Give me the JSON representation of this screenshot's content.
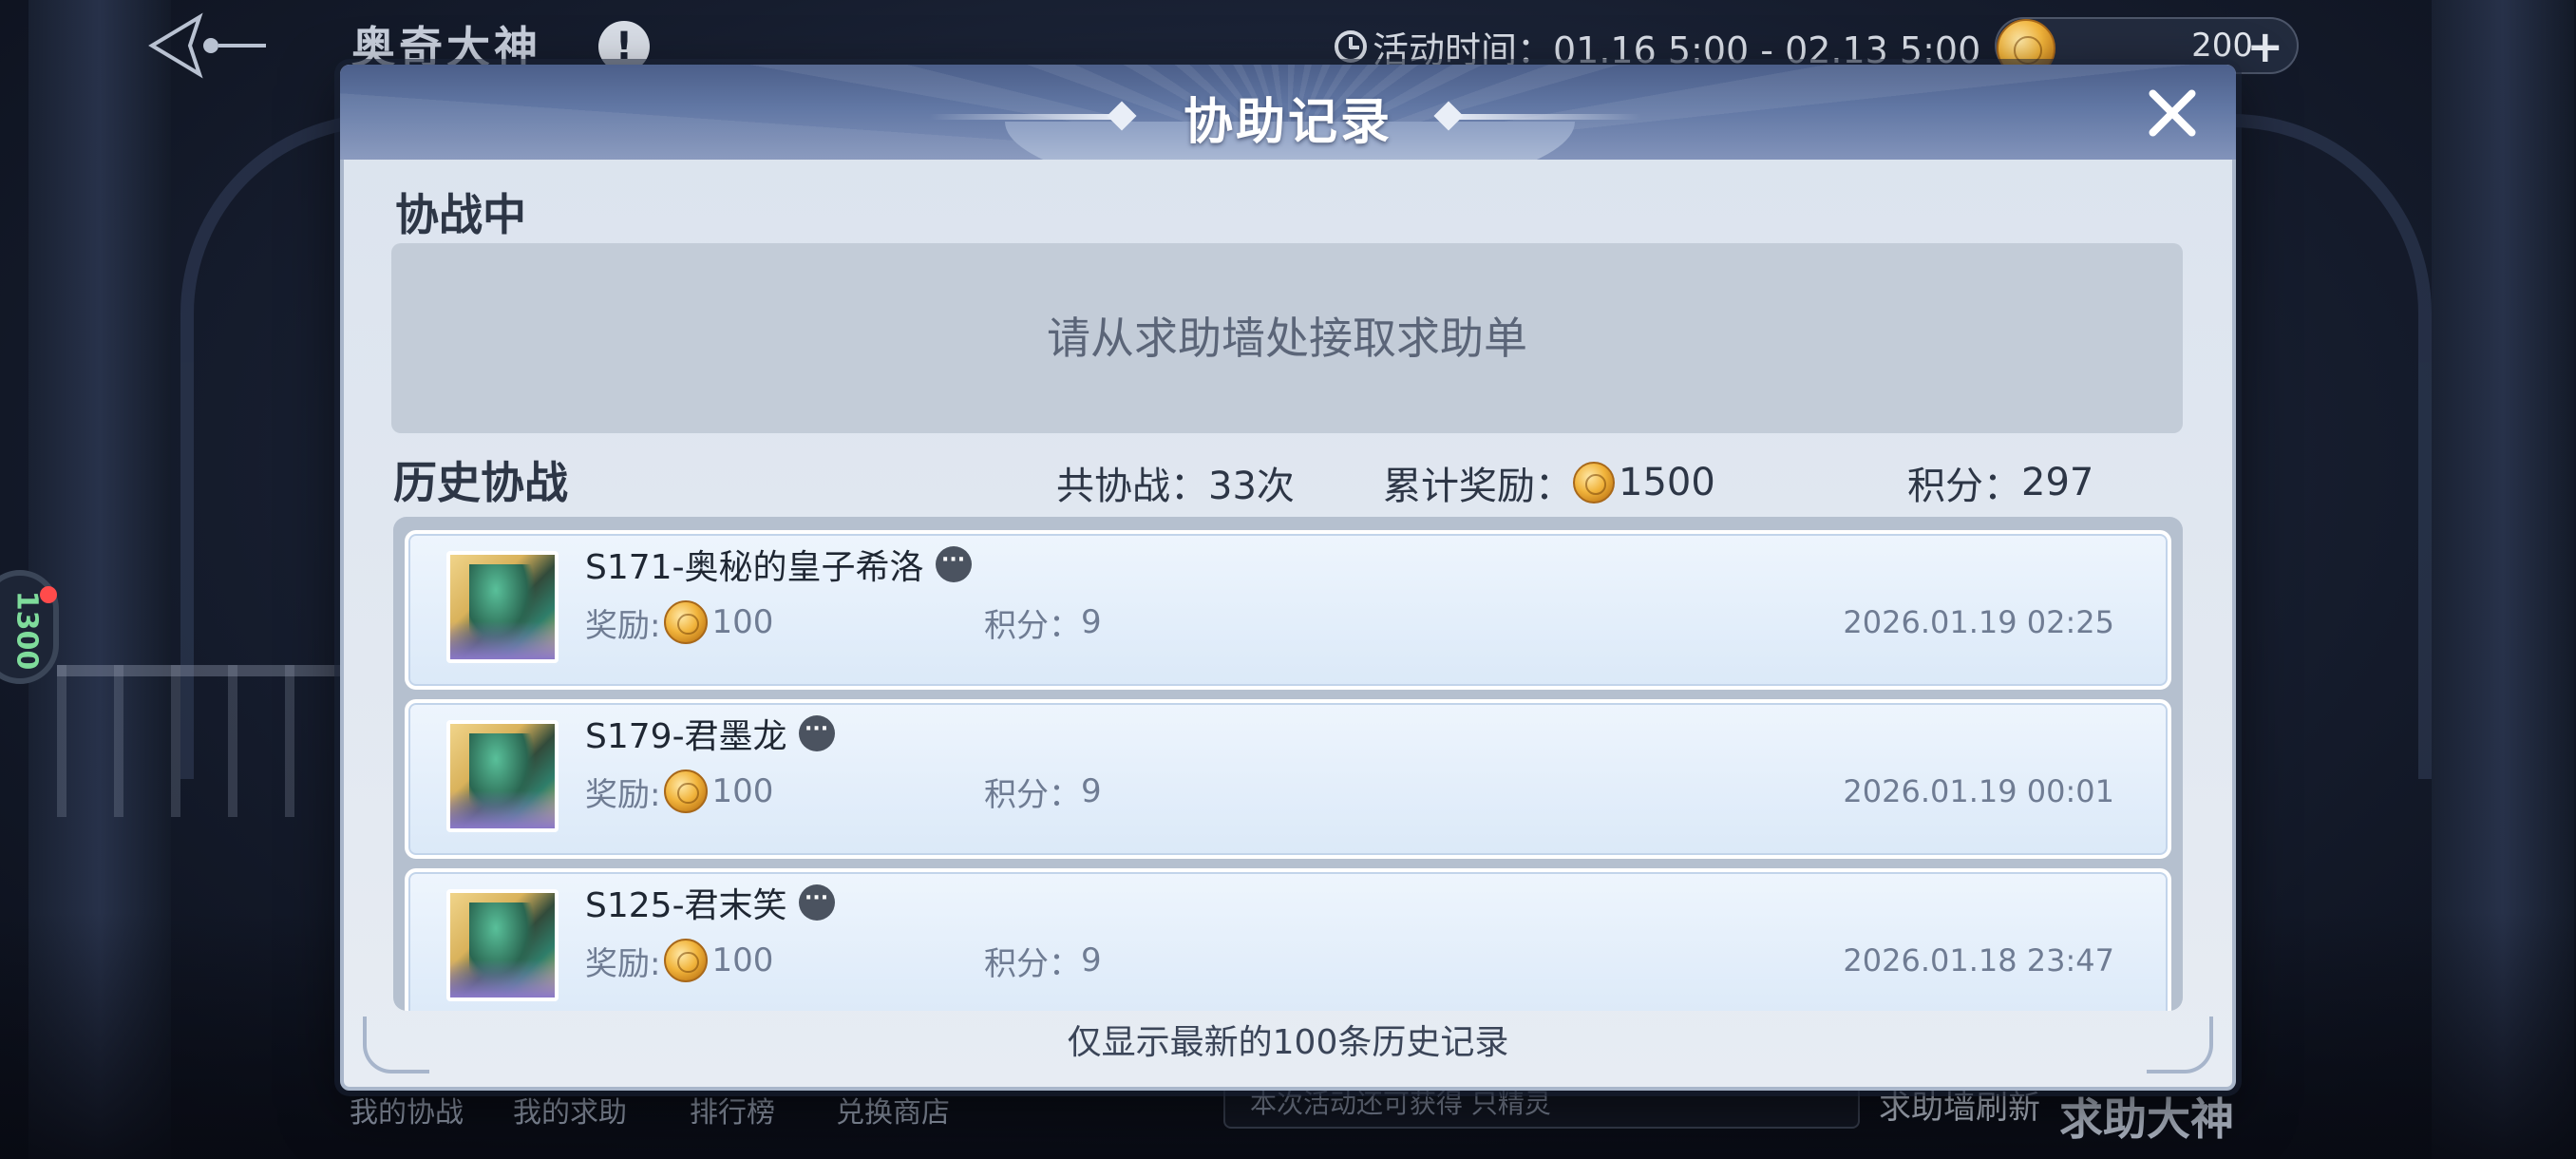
{
  "topbar": {
    "title": "奥奇大神",
    "event_time": "活动时间：01.16 5:00 - 02.13 5:00",
    "currency_value": "200",
    "plus_label": "+"
  },
  "side_badge_value": "1300",
  "bottom": {
    "nav": [
      "我的协战",
      "我的求助",
      "排行榜",
      "兑换商店"
    ],
    "message": "本次活动还可获得 只精灵",
    "refresh_label": "求助墙刷新",
    "help_god_label": "求助大神"
  },
  "dialog": {
    "title": "协助记录",
    "active_section_title": "协战中",
    "active_empty_hint": "请从求助墙处接取求助单",
    "history_section_title": "历史协战",
    "stats": {
      "total_label": "共协战：",
      "total_value": "33次",
      "reward_label": "累计奖励：",
      "reward_value": "1500",
      "score_label": "积分：",
      "score_value": "297"
    },
    "records": [
      {
        "name": "S171-奥秘的皇子希洛",
        "reward_label": "奖励:",
        "reward": "100",
        "score_label": "积分：",
        "score": "9",
        "time": "2026.01.19 02:25"
      },
      {
        "name": "S179-君墨龙",
        "reward_label": "奖励:",
        "reward": "100",
        "score_label": "积分：",
        "score": "9",
        "time": "2026.01.19 00:01"
      },
      {
        "name": "S125-君末笑",
        "reward_label": "奖励:",
        "reward": "100",
        "score_label": "积分：",
        "score": "9",
        "time": "2026.01.18 23:47"
      }
    ],
    "footer_note": "仅显示最新的100条历史记录"
  },
  "icons": {
    "coin": "gold-coin-icon",
    "more": "more-options-icon",
    "close": "close-icon",
    "clock": "clock-icon"
  },
  "colors": {
    "header_blue": "#5a6e9a",
    "panel_bg": "#e1e7f0",
    "record_bg": "#e4eef9",
    "text_muted": "#6f7c93"
  }
}
